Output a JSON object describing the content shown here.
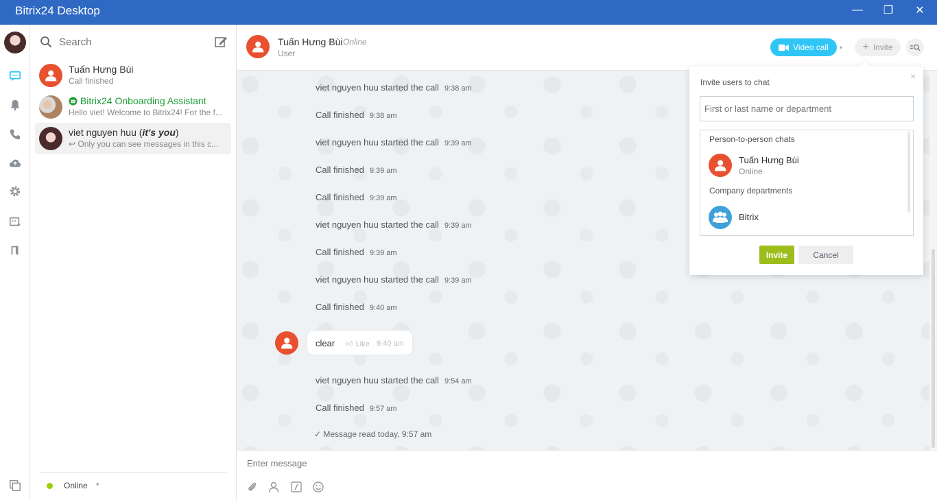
{
  "window": {
    "title": "Bitrix24 Desktop",
    "minimize_glyph": "—",
    "maximize_glyph": "❐",
    "close_glyph": "✕"
  },
  "colors": {
    "titlebar": "#2f69c3",
    "accent_blue": "#2fc6f6",
    "online_green": "#9dcf00",
    "invite_green": "#9dbd1c",
    "avatar_red": "#e9502f",
    "chat_bg": "#eef2f4"
  },
  "rail": {
    "icons": [
      "chat-icon",
      "bell-icon",
      "phone-icon",
      "cloud-drive-icon",
      "gear-icon",
      "bot-add-icon",
      "bookmark-icon",
      "windows-icon"
    ]
  },
  "search": {
    "placeholder": "Search"
  },
  "contacts": [
    {
      "name": "Tuấn Hưng Bùi",
      "sub": "Call finished"
    },
    {
      "name": "Bitrix24 Onboarding Assistant",
      "sub": "Hello viet! Welcome to Bitrix24! For the f..."
    },
    {
      "name": "viet nguyen huu",
      "name_suffix": "it's you",
      "sub": "Only you can see messages in this c..."
    }
  ],
  "status": {
    "label": "Online",
    "caret": "▾"
  },
  "chat_header": {
    "name": "Tuấn Hưng Bùi",
    "status": "Online",
    "role": "User",
    "video_call_label": "Video call",
    "video_caret": "▾",
    "invite_label": "Invite"
  },
  "messages": [
    {
      "text": "viet nguyen huu started the call",
      "time": "9:38 am"
    },
    {
      "text": "Call finished",
      "time": "9:38 am"
    },
    {
      "text": "viet nguyen huu started the call",
      "time": "9:39 am"
    },
    {
      "text": "Call finished",
      "time": "9:39 am"
    },
    {
      "text": "Call finished",
      "time": "9:39 am"
    },
    {
      "text": "viet nguyen huu started the call",
      "time": "9:39 am"
    },
    {
      "text": "Call finished",
      "time": "9:39 am"
    },
    {
      "text": "viet nguyen huu started the call",
      "time": "9:39 am"
    },
    {
      "text": "Call finished",
      "time": "9:40 am"
    }
  ],
  "bubble": {
    "text": "clear",
    "like": "Like",
    "time": "9:40 am"
  },
  "messages_after": [
    {
      "text": "viet nguyen huu started the call",
      "time": "9:54 am"
    },
    {
      "text": "Call finished",
      "time": "9:57 am"
    }
  ],
  "read_receipt": "Message read today, 9:57 am",
  "composer": {
    "placeholder": "Enter message"
  },
  "invite_popup": {
    "title": "Invite users to chat",
    "close_glyph": "×",
    "search_placeholder": "First or last name or department",
    "section_p2p": "Person-to-person chats",
    "p2p_name": "Tuấn Hưng Bùi",
    "p2p_status": "Online",
    "section_departments": "Company departments",
    "department_name": "Bitrix",
    "invite_button": "Invite",
    "cancel_button": "Cancel"
  }
}
